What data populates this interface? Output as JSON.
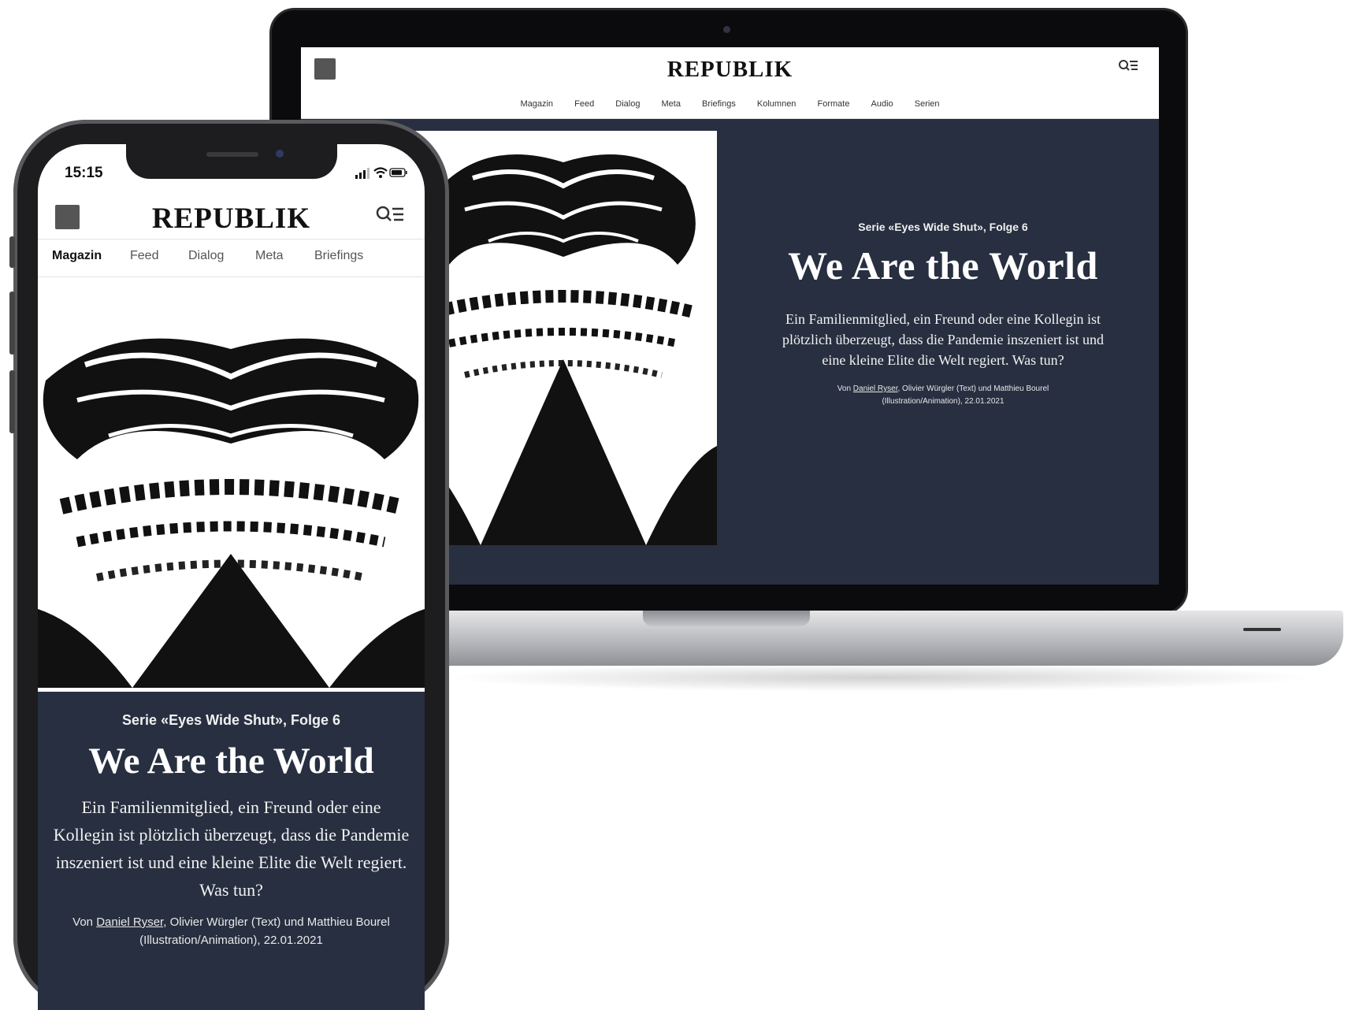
{
  "laptop": {
    "brand": "REPUBLIK",
    "nav": [
      "Magazin",
      "Feed",
      "Dialog",
      "Meta",
      "Briefings",
      "Kolumnen",
      "Formate",
      "Audio",
      "Serien"
    ],
    "serie": "Serie «Eyes Wide Shut», Folge 6",
    "title": "We Are the World",
    "lead": "Ein Familienmitglied, ein Freund oder eine Kollegin ist plötzlich überzeugt, dass die Pandemie inszeniert ist und eine kleine Elite die Welt regiert. Was tun?",
    "byline_prefix": "Von ",
    "byline_author": "Daniel Ryser",
    "byline_rest": ", Olivier Würgler (Text) und Matthieu Bourel (Illustration/Animation), 22.01.2021"
  },
  "phone": {
    "time": "15:15",
    "brand": "REPUBLIK",
    "nav": [
      "Magazin",
      "Feed",
      "Dialog",
      "Meta",
      "Briefings"
    ],
    "nav_active": "Magazin",
    "serie": "Serie «Eyes Wide Shut», Folge 6",
    "title": "We Are the World",
    "lead": "Ein Familienmitglied, ein Freund oder eine Kollegin ist plötzlich überzeugt, dass die Pandemie inszeniert ist und eine kleine Elite die Welt regiert. Was tun?",
    "byline_prefix": "Von ",
    "byline_author": "Daniel Ryser",
    "byline_rest": ", Olivier Würgler (Text) und Matthieu Bourel (Illustration/Animation), 22.01.2021"
  },
  "icons": {
    "avatar": "avatar-icon",
    "search_menu": "search-menu-icon",
    "signal": "cellular-signal-icon",
    "wifi": "wifi-icon",
    "battery": "battery-icon"
  },
  "colors": {
    "article_bg": "#272f40",
    "header_bg": "#ffffff",
    "text_light": "#ffffff",
    "text_dark": "#111111"
  }
}
